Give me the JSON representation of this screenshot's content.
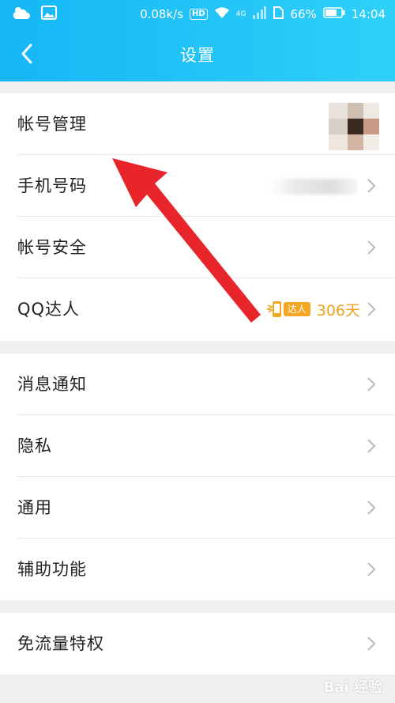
{
  "status_bar": {
    "net_speed": "0.08k/s",
    "hd": "HD",
    "signal_label": "4G",
    "battery": "66%",
    "time": "14:04"
  },
  "header": {
    "title": "设置"
  },
  "groups": [
    {
      "items": [
        {
          "label": "帐号管理"
        },
        {
          "label": "手机号码"
        },
        {
          "label": "帐号安全"
        },
        {
          "label": "QQ达人",
          "badge": "达人",
          "days": "306天"
        }
      ]
    },
    {
      "items": [
        {
          "label": "消息通知"
        },
        {
          "label": "隐私"
        },
        {
          "label": "通用"
        },
        {
          "label": "辅助功能"
        }
      ]
    },
    {
      "items": [
        {
          "label": "免流量特权"
        }
      ]
    }
  ],
  "watermark": "Bai 经验",
  "colors": {
    "header_start": "#15b7f5",
    "header_end": "#2fd0f8",
    "talent_orange": "#f0a21c",
    "arrow_red": "#e8252b"
  }
}
